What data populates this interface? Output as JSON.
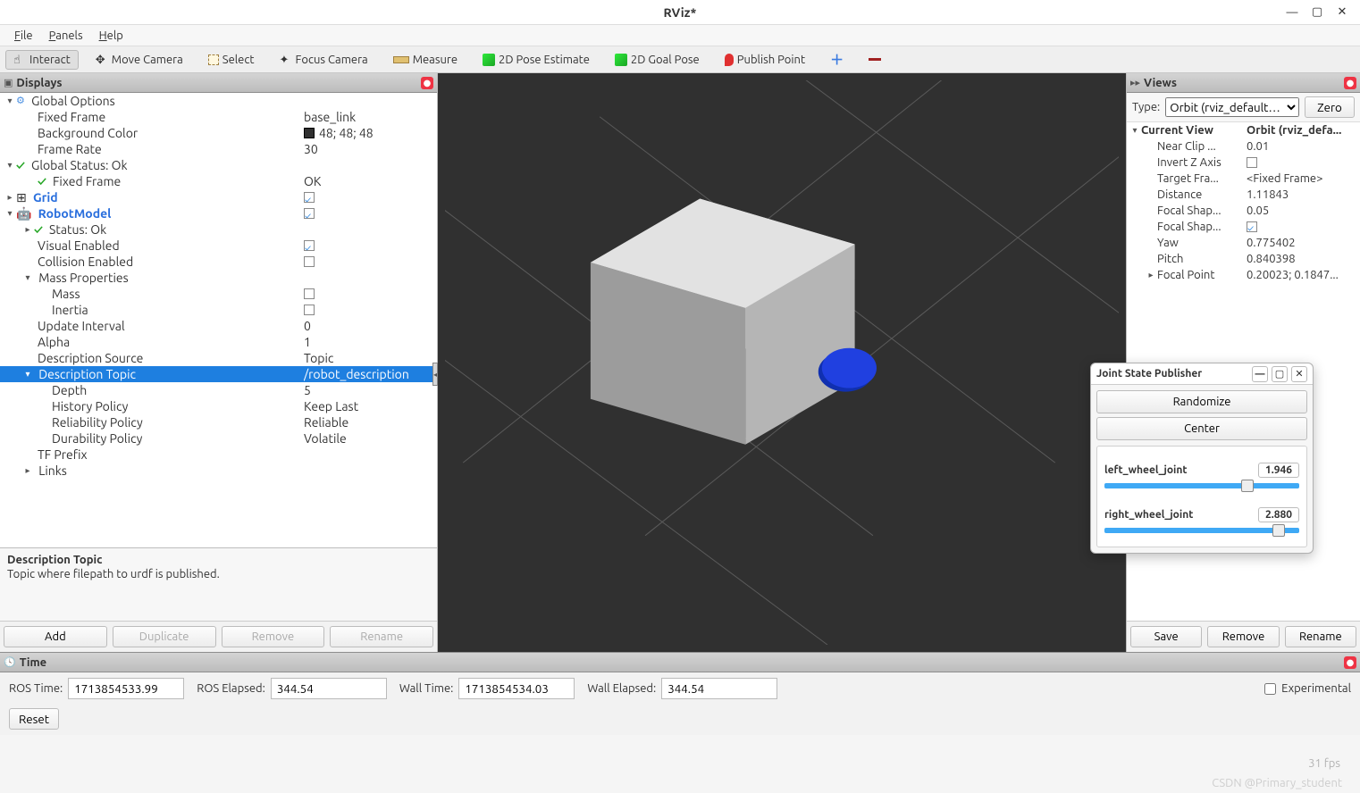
{
  "window": {
    "title": "RViz*"
  },
  "menubar": [
    "File",
    "Panels",
    "Help"
  ],
  "toolbar": {
    "interact": "Interact",
    "move_camera": "Move Camera",
    "select": "Select",
    "focus_camera": "Focus Camera",
    "measure": "Measure",
    "pose_estimate": "2D Pose Estimate",
    "goal_pose": "2D Goal Pose",
    "publish_point": "Publish Point"
  },
  "displays": {
    "panel_title": "Displays",
    "global_options": {
      "label": "Global Options",
      "fixed_frame": {
        "label": "Fixed Frame",
        "value": "base_link"
      },
      "background_color": {
        "label": "Background Color",
        "value": "48; 48; 48"
      },
      "frame_rate": {
        "label": "Frame Rate",
        "value": "30"
      }
    },
    "global_status": {
      "label": "Global Status: Ok",
      "fixed_frame": {
        "label": "Fixed Frame",
        "value": "OK"
      }
    },
    "grid": {
      "label": "Grid"
    },
    "robotmodel": {
      "label": "RobotModel",
      "status": {
        "label": "Status: Ok"
      },
      "visual_enabled": {
        "label": "Visual Enabled"
      },
      "collision_enabled": {
        "label": "Collision Enabled"
      },
      "mass_properties": {
        "label": "Mass Properties",
        "mass": {
          "label": "Mass"
        },
        "inertia": {
          "label": "Inertia"
        }
      },
      "update_interval": {
        "label": "Update Interval",
        "value": "0"
      },
      "alpha": {
        "label": "Alpha",
        "value": "1"
      },
      "description_source": {
        "label": "Description Source",
        "value": "Topic"
      },
      "description_topic": {
        "label": "Description Topic",
        "value": "/robot_description",
        "depth": {
          "label": "Depth",
          "value": "5"
        },
        "history_policy": {
          "label": "History Policy",
          "value": "Keep Last"
        },
        "reliability_policy": {
          "label": "Reliability Policy",
          "value": "Reliable"
        },
        "durability_policy": {
          "label": "Durability Policy",
          "value": "Volatile"
        }
      },
      "tf_prefix": {
        "label": "TF Prefix"
      },
      "links": {
        "label": "Links"
      }
    },
    "description": {
      "title": "Description Topic",
      "body": "Topic where filepath to urdf is published."
    },
    "buttons": {
      "add": "Add",
      "duplicate": "Duplicate",
      "remove": "Remove",
      "rename": "Rename"
    }
  },
  "views": {
    "panel_title": "Views",
    "type_label": "Type:",
    "type_value": "Orbit (rviz_default…",
    "zero": "Zero",
    "current_view": {
      "label": "Current View",
      "value": "Orbit (rviz_defa..."
    },
    "near_clip": {
      "label": "Near Clip ...",
      "value": "0.01"
    },
    "invert_z": {
      "label": "Invert Z Axis"
    },
    "target_frame": {
      "label": "Target Fra...",
      "value": "<Fixed Frame>"
    },
    "distance": {
      "label": "Distance",
      "value": "1.11843"
    },
    "focal_shape1": {
      "label": "Focal Shap...",
      "value": "0.05"
    },
    "focal_shape2": {
      "label": "Focal Shap..."
    },
    "yaw": {
      "label": "Yaw",
      "value": "0.775402"
    },
    "pitch": {
      "label": "Pitch",
      "value": "0.840398"
    },
    "focal_point": {
      "label": "Focal Point",
      "value": "0.20023; 0.1847..."
    },
    "buttons": {
      "save": "Save",
      "remove": "Remove",
      "rename": "Rename"
    }
  },
  "time": {
    "panel_title": "Time",
    "ros_time": {
      "label": "ROS Time:",
      "value": "1713854533.99"
    },
    "ros_elapsed": {
      "label": "ROS Elapsed:",
      "value": "344.54"
    },
    "wall_time": {
      "label": "Wall Time:",
      "value": "1713854534.03"
    },
    "wall_elapsed": {
      "label": "Wall Elapsed:",
      "value": "344.54"
    },
    "experimental": "Experimental",
    "reset": "Reset"
  },
  "jsp": {
    "title": "Joint State Publisher",
    "randomize": "Randomize",
    "center": "Center",
    "joints": [
      {
        "name": "left_wheel_joint",
        "value": "1.946",
        "pct": 75
      },
      {
        "name": "right_wheel_joint",
        "value": "2.880",
        "pct": 92
      }
    ]
  },
  "fps": "31 fps",
  "watermark": "CSDN @Primary_student"
}
